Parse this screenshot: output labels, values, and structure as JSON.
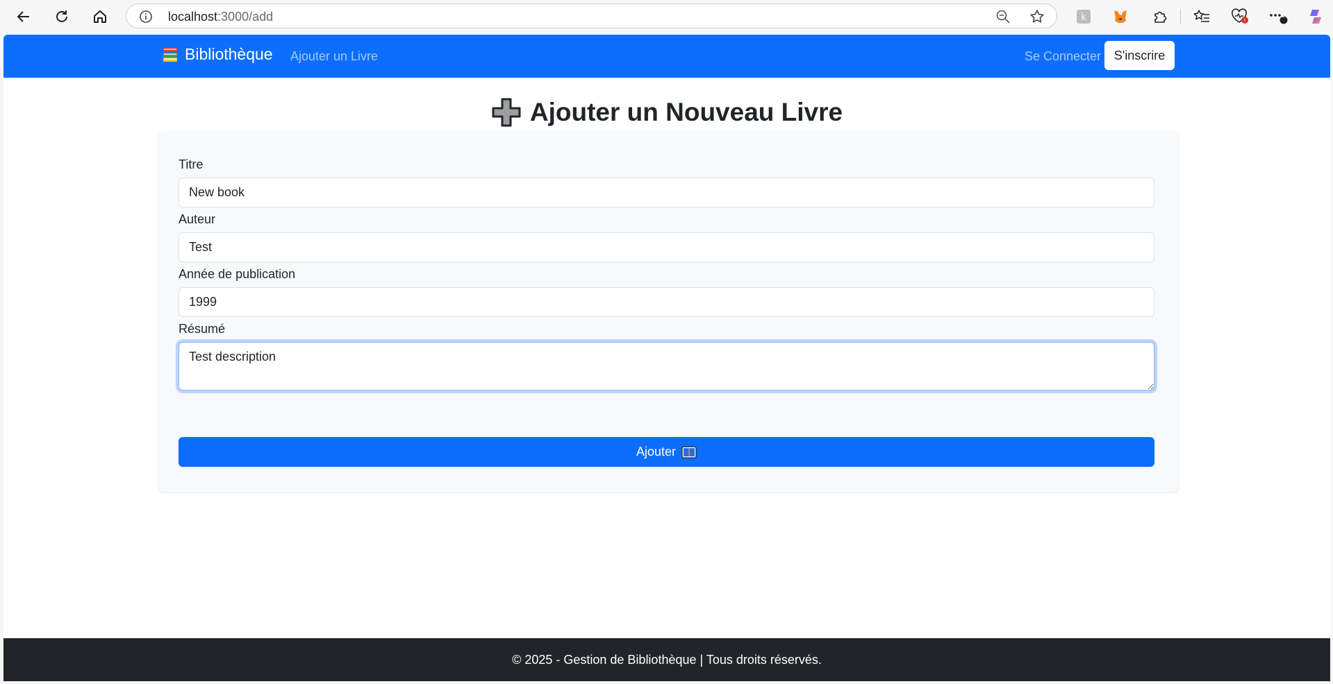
{
  "browser": {
    "url_host": "localhost",
    "url_path": ":3000/add",
    "icons": [
      "back-icon",
      "refresh-icon",
      "home-icon",
      "site-info-icon",
      "zoom-out-icon",
      "favorite-star-icon",
      "extension-k-icon",
      "metamask-fox-icon",
      "extensions-puzzle-icon",
      "favorites-list-icon",
      "browser-health-icon",
      "more-icon",
      "copilot-icon"
    ],
    "more_badge": "1"
  },
  "navbar": {
    "brand": "Bibliothèque",
    "brand_icon": "books-icon",
    "link_add": "Ajouter un Livre",
    "link_login": "Se Connecter",
    "signup_label": "S'inscrire",
    "color": "#0d6efd"
  },
  "page": {
    "title": "Ajouter un Nouveau Livre",
    "title_icon": "heavy-plus-icon"
  },
  "form": {
    "title_label": "Titre",
    "title_value": "New book",
    "author_label": "Auteur",
    "author_value": "Test",
    "year_label": "Année de publication",
    "year_value": "1999",
    "summary_label": "Résumé",
    "summary_value": "Test description",
    "submit_label": "Ajouter",
    "submit_icon": "open-book-icon"
  },
  "footer": {
    "text": "© 2025 - Gestion de Bibliothèque | Tous droits réservés.",
    "color": "#212529"
  }
}
